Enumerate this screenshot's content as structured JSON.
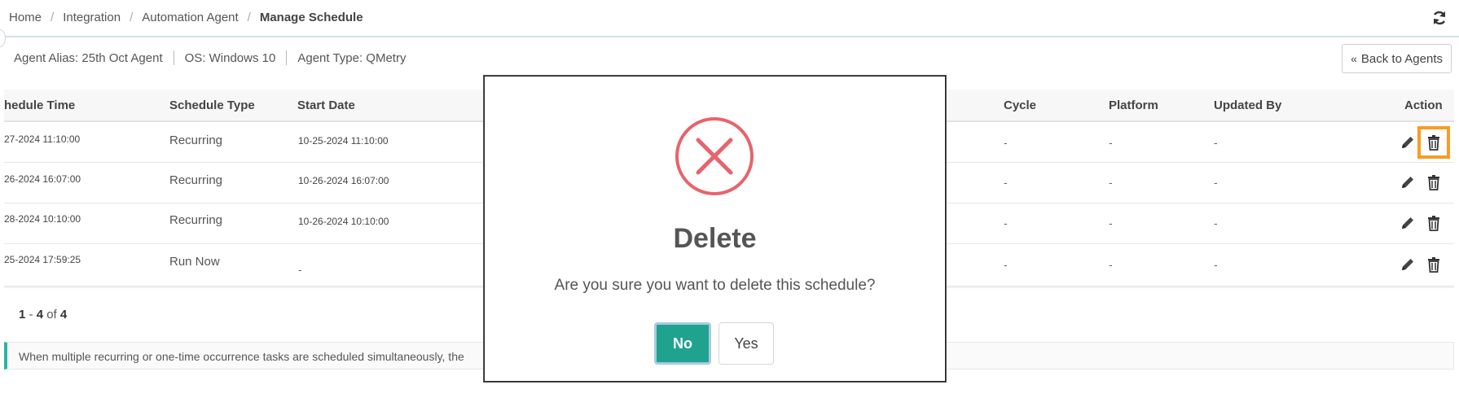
{
  "breadcrumb": {
    "items": [
      "Home",
      "Integration",
      "Automation Agent"
    ],
    "separator": "/",
    "current": "Manage Schedule"
  },
  "agent": {
    "alias": "Agent Alias: 25th Oct Agent",
    "os": "OS: Windows 10",
    "type": "Agent Type: QMetry"
  },
  "back_button": {
    "chevron": "«",
    "label": "Back to Agents"
  },
  "table": {
    "headers": {
      "schedule_time": "hedule Time",
      "schedule_type": "Schedule Type",
      "start_date": "Start Date",
      "cycle": "Cycle",
      "platform": "Platform",
      "updated_by": "Updated By",
      "action": "Action"
    },
    "rows": [
      {
        "schedule_time": "27-2024 11:10:00",
        "schedule_type": "Recurring",
        "start_date": "10-25-2024 11:10:00",
        "cycle": "-",
        "platform": "-",
        "updated_by": "-"
      },
      {
        "schedule_time": "26-2024 16:07:00",
        "schedule_type": "Recurring",
        "start_date": "10-26-2024 16:07:00",
        "cycle": "-",
        "platform": "-",
        "updated_by": "-"
      },
      {
        "schedule_time": "28-2024 10:10:00",
        "schedule_type": "Recurring",
        "start_date": "10-26-2024 10:10:00",
        "cycle": "-",
        "platform": "-",
        "updated_by": "-"
      },
      {
        "schedule_time": "25-2024 17:59:25",
        "schedule_type": "Run Now",
        "start_date": "-",
        "cycle": "-",
        "platform": "-",
        "updated_by": "-"
      }
    ]
  },
  "pagination": {
    "from": "1",
    "dash": "-",
    "to": "4",
    "of": "of",
    "total": "4"
  },
  "notice": "When multiple recurring or one-time occurrence tasks are scheduled simultaneously, the",
  "modal": {
    "title": "Delete",
    "message": "Are you sure you want to delete this schedule?",
    "no_label": "No",
    "yes_label": "Yes",
    "icon": "x-circle-icon"
  },
  "colors": {
    "accent_teal": "#1fa38f",
    "danger_red": "#e8636b",
    "highlight_orange": "#f79c26",
    "notice_border": "#26b5a6"
  }
}
